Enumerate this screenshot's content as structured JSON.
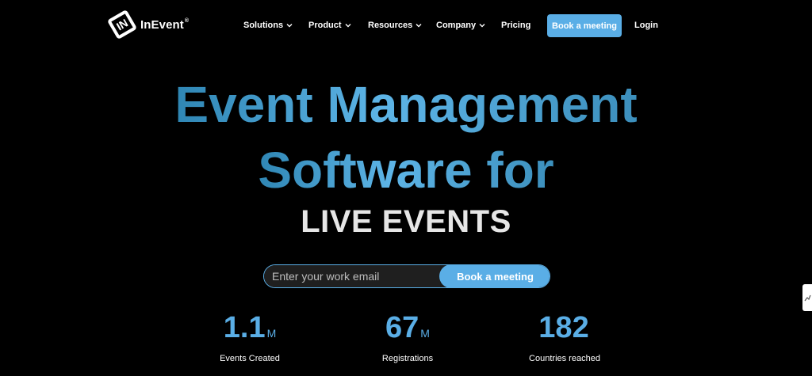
{
  "header": {
    "logo_text": "InEvent",
    "logo_reg": "®",
    "nav": [
      {
        "label": "Solutions",
        "dropdown": true
      },
      {
        "label": "Product",
        "dropdown": true
      },
      {
        "label": "Resources",
        "dropdown": true
      },
      {
        "label": "Company",
        "dropdown": true
      },
      {
        "label": "Pricing",
        "dropdown": false
      }
    ],
    "cta_label": "Book a meeting",
    "login_label": "Login"
  },
  "hero": {
    "line1": "Event Management",
    "line2": "Software for",
    "line3": "LIVE EVENTS"
  },
  "form": {
    "email_placeholder": "Enter your work email",
    "email_value": "",
    "submit_label": "Book a meeting"
  },
  "stats": [
    {
      "value": "1.1",
      "unit": "M",
      "label": "Events Created"
    },
    {
      "value": "67",
      "unit": "M",
      "label": "Registrations"
    },
    {
      "value": "182",
      "unit": "",
      "label": "Countries reached"
    }
  ],
  "colors": {
    "background": "#000000",
    "accent": "#5aaee6",
    "text": "#ffffff",
    "hero_subtext": "#e6e6e6"
  },
  "icons": {
    "logo": "inevent-logo-icon",
    "nav_dropdown": "chevron-down-icon",
    "side_tab": "chart-icon"
  }
}
